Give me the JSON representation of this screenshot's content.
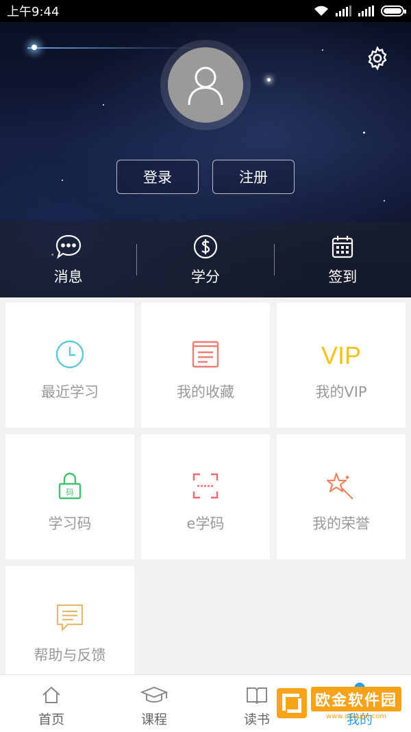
{
  "status_bar": {
    "time": "上午9:44"
  },
  "profile": {
    "login_label": "登录",
    "register_label": "注册"
  },
  "quick_actions": [
    {
      "label": "消息",
      "icon": "message-icon"
    },
    {
      "label": "学分",
      "icon": "credit-icon"
    },
    {
      "label": "签到",
      "icon": "calendar-icon"
    }
  ],
  "tiles": [
    {
      "label": "最近学习",
      "icon": "clock-icon",
      "color": "#5bc8d6"
    },
    {
      "label": "我的收藏",
      "icon": "book-icon",
      "color": "#f07b72"
    },
    {
      "label": "我的VIP",
      "icon": "vip-icon",
      "icon_text": "VIP",
      "color": "#f5c21b"
    },
    {
      "label": "学习码",
      "icon": "lock-icon",
      "icon_text": "码",
      "color": "#3ec26b"
    },
    {
      "label": "e学码",
      "icon": "scan-icon",
      "color": "#f06a6a"
    },
    {
      "label": "我的荣誉",
      "icon": "star-wand-icon",
      "color": "#f2825e"
    },
    {
      "label": "帮助与反馈",
      "icon": "feedback-icon",
      "color": "#e8b96a"
    }
  ],
  "tabs": [
    {
      "label": "首页",
      "icon": "home-icon"
    },
    {
      "label": "课程",
      "icon": "graduation-cap-icon"
    },
    {
      "label": "读书",
      "icon": "open-book-icon"
    },
    {
      "label": "我的",
      "icon": "user-icon",
      "active": true
    }
  ],
  "watermark": {
    "main": "欧金软件园",
    "sub": "www.apoujin.com"
  },
  "colors": {
    "accent": "#2a9fe8",
    "watermark": "#f7a21b"
  }
}
